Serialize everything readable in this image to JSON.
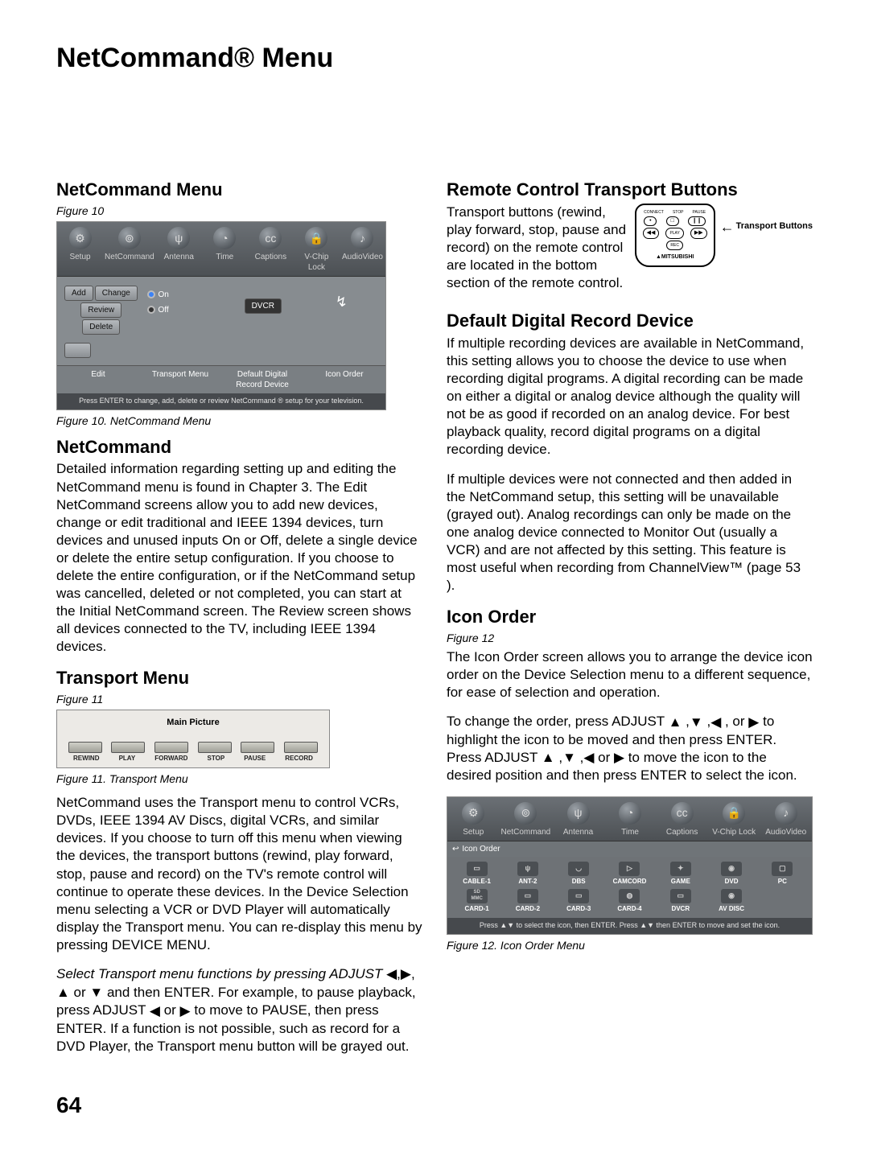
{
  "page_title": "NetCommand® Menu",
  "page_number": "64",
  "left": {
    "h1": "NetCommand Menu",
    "fig10_label": "Figure 10",
    "fig10_caption": "Figure 10.  NetCommand Menu",
    "nc_tabs": [
      "Setup",
      "NetCommand",
      "Antenna",
      "Time",
      "Captions",
      "V-Chip Lock",
      "AudioVideo"
    ],
    "nc_edit_btns": {
      "add": "Add",
      "change": "Change",
      "review": "Review",
      "delete": "Delete"
    },
    "nc_transport": {
      "on": "On",
      "off": "Off"
    },
    "nc_record_device": "DVCR",
    "nc_bottom": {
      "edit": "Edit",
      "transport": "Transport Menu",
      "record": "Default Digital\nRecord Device",
      "icon": "Icon Order"
    },
    "nc_hint": "Press ENTER to change, add, delete or review NetCommand ® setup for your television.",
    "h2_netcommand": "NetCommand",
    "p_netcommand": "Detailed information regarding setting up and editing the NetCommand menu is found in Chapter 3. The Edit NetCommand screens allow you to add new devices, change or edit traditional and IEEE 1394 devices, turn devices and unused inputs On or Off, delete a single device or delete the entire setup configuration.  If you choose to delete the entire configuration, or if the NetCommand setup was cancelled, deleted or not completed, you can start at the Initial NetCommand screen.  The Review screen shows all devices connected to the TV, including IEEE 1394 devices.",
    "h2_transport": "Transport Menu",
    "fig11_label": "Figure 11",
    "transport_title": "Main Picture",
    "transport_btns": [
      "REWIND",
      "PLAY",
      "FORWARD",
      "STOP",
      "PAUSE",
      "RECORD"
    ],
    "fig11_caption": "Figure 11.  Transport Menu",
    "p_transport1": "NetCommand uses the Transport menu to control VCRs, DVDs, IEEE 1394 AV Discs, digital VCRs, and similar devices.  If you choose to turn off this menu when viewing the devices, the transport buttons (rewind, play forward, stop, pause and record) on the TV's remote control will continue to operate these devices.  In the Device Selection menu selecting a VCR or DVD Player will automatically display the Transport menu. You can re-display this menu by pressing DEVICE MENU.",
    "p_transport2a": "Select Transport menu functions by pressing ADJUST ",
    "p_transport2b": " and then ENTER.  For example, to pause playback, press ADJUST ",
    "p_transport2c": " to move to PAUSE, then press ENTER.  If a function is not possible, such as record for a DVD Player, the Transport menu button will be grayed out."
  },
  "right": {
    "h2_remote": "Remote Control Transport Buttons",
    "p_remote": "Transport  buttons (rewind, play forward, stop, pause and record) on the remote control are located in the bottom section of the remote control.",
    "remote_labels": {
      "connect": "CONNECT",
      "stop": "STOP",
      "pause": "PAUSE",
      "play": "PLAY",
      "rec": "REC",
      "brand": "▲MITSUBISHI"
    },
    "callout": "Transport Buttons",
    "h2_default": "Default Digital Record Device",
    "p_default1": "If multiple recording devices are available in NetCommand, this setting allows you to choose the device to use when recording digital programs.  A digital recording can be made on either a digital or analog device although the quality will not be as good if recorded on an analog device.  For best playback quality, record digital programs on a digital recording device.",
    "p_default2": "If multiple devices were not connected and then added in the NetCommand setup, this setting will be unavailable (grayed out).  Analog recordings can only be made on the one analog device connected to Monitor Out  (usually a VCR) and are not affected by this setting. This feature is most useful when recording from  ChannelView™ (page 53 ).",
    "h2_icon": "Icon Order",
    "fig12_label": "Figure 12",
    "p_icon1": "The Icon Order screen allows you to arrange the device icon order on the Device Selection menu to a different sequence, for ease of selection and operation.",
    "p_icon2a": "To change the order, press ADJUST ",
    "p_icon2b": " to highlight the icon to be moved and then press ENTER.  Press ADJUST ",
    "p_icon2c": " to move the icon to the desired position and then press ENTER to select the icon.",
    "icon_order_title": "Icon Order",
    "icon_grid": [
      "CABLE-1",
      "ANT-2",
      "DBS",
      "CAMCORD",
      "GAME",
      "DVD",
      "PC",
      "CARD-1",
      "CARD-2",
      "CARD-3",
      "CARD-4",
      "DVCR",
      "AV DISC",
      ""
    ],
    "icon_hint": "Press ▲▼ to select the icon, then ENTER.  Press ▲▼ then ENTER to move and set the icon.",
    "fig12_caption": "Figure 12.  Icon Order Menu"
  }
}
